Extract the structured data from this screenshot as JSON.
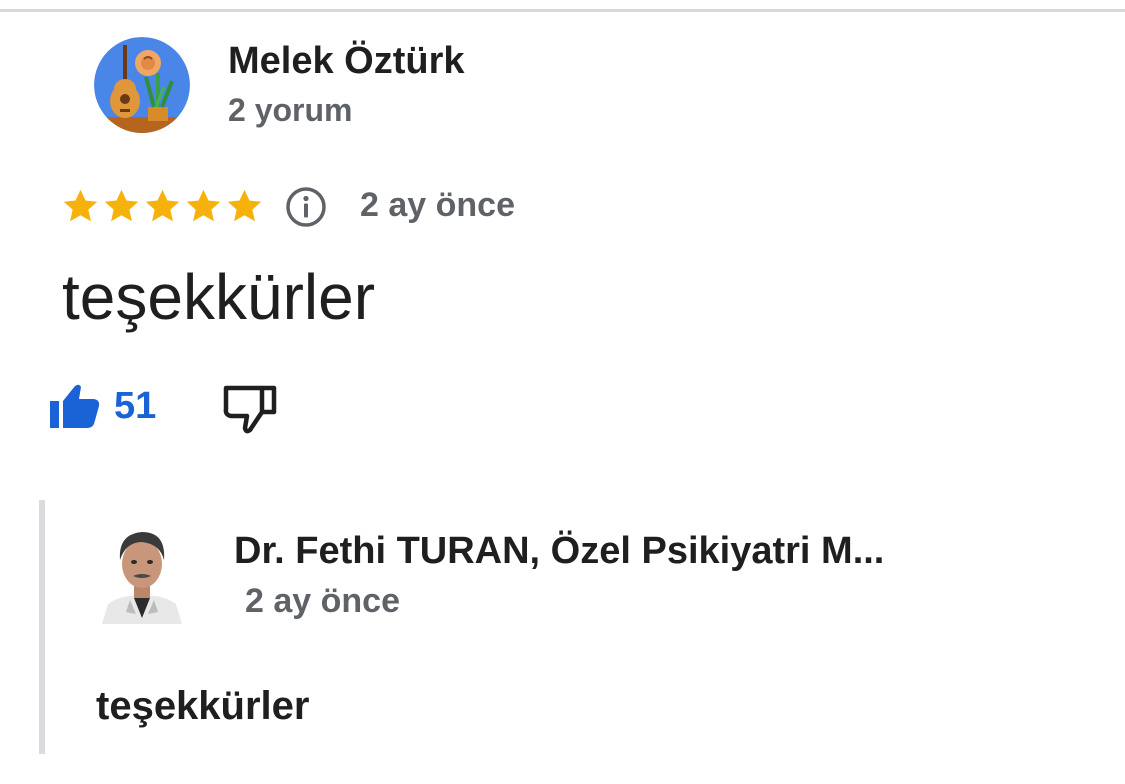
{
  "review": {
    "author_name": "Melek Öztürk",
    "author_meta": "2 yorum",
    "rating": 5,
    "rating_max": 5,
    "date": "2 ay önce",
    "text": "teşekkürler",
    "likes": "51",
    "icons": {
      "avatar": "guitar-plant-avatar",
      "info": "info-icon",
      "like": "thumbs-up-icon",
      "dislike": "thumbs-down-icon",
      "star": "star-icon"
    }
  },
  "owner_reply": {
    "name": "Dr. Fethi TURAN, Özel Psikiyatri M...",
    "date": "2 ay önce",
    "text": "teşekkürler",
    "icons": {
      "avatar": "doctor-photo-avatar"
    }
  },
  "colors": {
    "star": "#f6b20a",
    "like_blue": "#1a63d6",
    "meta_gray": "#5f6368",
    "text_dark": "#1f1f1f",
    "reply_bar": "#dadce0",
    "top_rule": "#d9d9d9"
  }
}
